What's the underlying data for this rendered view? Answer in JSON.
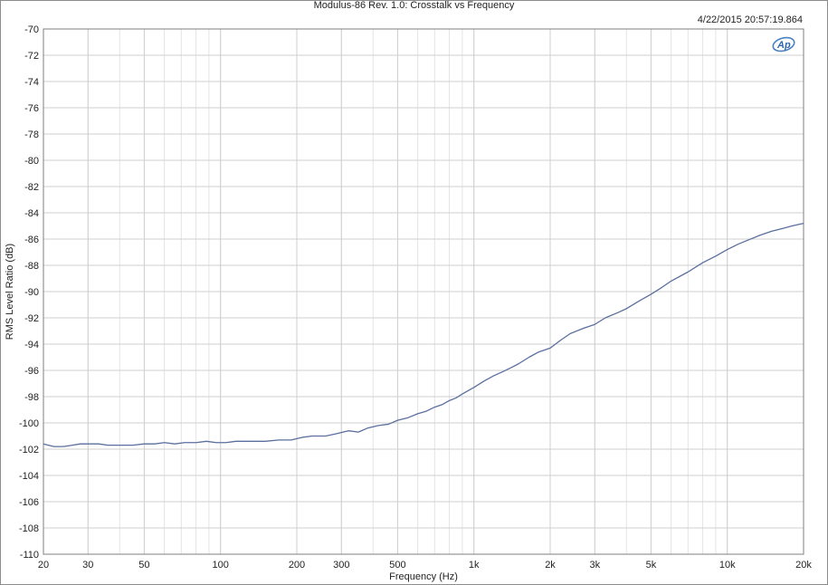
{
  "chart_data": {
    "type": "line",
    "title": "Modulus-86 Rev. 1.0: Crosstalk vs Frequency",
    "timestamp": "4/22/2015 20:57:19.864",
    "xlabel": "Frequency (Hz)",
    "ylabel": "RMS Level Ratio (dB)",
    "x_scale": "log",
    "xlim": [
      20,
      20000
    ],
    "ylim": [
      -110,
      -70
    ],
    "grid": true,
    "x_ticks": [
      {
        "value": 20,
        "label": "20"
      },
      {
        "value": 30,
        "label": "30"
      },
      {
        "value": 50,
        "label": "50"
      },
      {
        "value": 100,
        "label": "100"
      },
      {
        "value": 200,
        "label": "200"
      },
      {
        "value": 300,
        "label": "300"
      },
      {
        "value": 500,
        "label": "500"
      },
      {
        "value": 1000,
        "label": "1k"
      },
      {
        "value": 2000,
        "label": "2k"
      },
      {
        "value": 3000,
        "label": "3k"
      },
      {
        "value": 5000,
        "label": "5k"
      },
      {
        "value": 10000,
        "label": "10k"
      },
      {
        "value": 20000,
        "label": "20k"
      }
    ],
    "y_ticks": [
      -70,
      -72,
      -74,
      -76,
      -78,
      -80,
      -82,
      -84,
      -86,
      -88,
      -90,
      -92,
      -94,
      -96,
      -98,
      -100,
      -102,
      -104,
      -106,
      -108,
      -110
    ],
    "series": [
      {
        "color": "#5a6f9e",
        "x": [
          20,
          22,
          24,
          26,
          28,
          30,
          33,
          36,
          40,
          45,
          50,
          55,
          60,
          66,
          72,
          80,
          88,
          96,
          105,
          115,
          130,
          150,
          170,
          190,
          210,
          230,
          260,
          290,
          320,
          350,
          380,
          420,
          460,
          500,
          550,
          600,
          650,
          700,
          750,
          800,
          850,
          900,
          1000,
          1100,
          1200,
          1300,
          1400,
          1500,
          1650,
          1800,
          2000,
          2200,
          2400,
          2700,
          3000,
          3300,
          3700,
          4000,
          4500,
          5000,
          5500,
          6000,
          7000,
          8000,
          9000,
          10000,
          11000,
          12000,
          13500,
          15000,
          16500,
          18000,
          20000
        ],
        "y": [
          -101.6,
          -101.8,
          -101.8,
          -101.7,
          -101.6,
          -101.6,
          -101.6,
          -101.7,
          -101.7,
          -101.7,
          -101.6,
          -101.6,
          -101.5,
          -101.6,
          -101.5,
          -101.5,
          -101.4,
          -101.5,
          -101.5,
          -101.4,
          -101.4,
          -101.4,
          -101.3,
          -101.3,
          -101.1,
          -101.0,
          -101.0,
          -100.8,
          -100.6,
          -100.7,
          -100.4,
          -100.2,
          -100.1,
          -99.8,
          -99.6,
          -99.3,
          -99.1,
          -98.8,
          -98.6,
          -98.3,
          -98.1,
          -97.8,
          -97.3,
          -96.8,
          -96.4,
          -96.1,
          -95.8,
          -95.5,
          -95.0,
          -94.6,
          -94.3,
          -93.7,
          -93.2,
          -92.8,
          -92.5,
          -92.0,
          -91.6,
          -91.3,
          -90.7,
          -90.2,
          -89.7,
          -89.2,
          -88.5,
          -87.8,
          -87.3,
          -86.8,
          -86.4,
          -86.1,
          -85.7,
          -85.4,
          -85.2,
          -85.0,
          -84.8
        ]
      }
    ]
  }
}
